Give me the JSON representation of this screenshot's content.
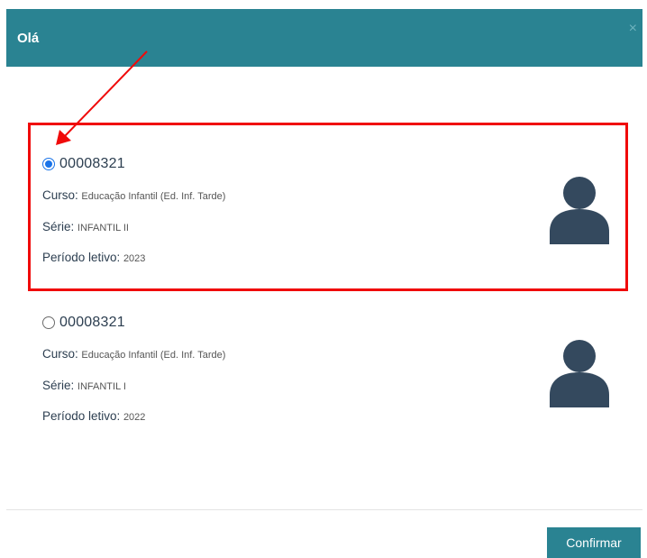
{
  "dialog": {
    "title": "Olá",
    "close_icon": "close-icon",
    "close_glyph": "×"
  },
  "enrollments": [
    {
      "selected": true,
      "id": "00008321",
      "curso_label": "Curso:",
      "curso_value": "Educação Infantil (Ed. Inf. Tarde)",
      "serie_label": "Série:",
      "serie_value": "INFANTIL II",
      "periodo_label": "Período letivo:",
      "periodo_value": "2023",
      "avatar_icon": "user-silhouette-icon"
    },
    {
      "selected": false,
      "id": "00008321",
      "curso_label": "Curso:",
      "curso_value": "Educação Infantil (Ed. Inf. Tarde)",
      "serie_label": "Série:",
      "serie_value": "INFANTIL I",
      "periodo_label": "Período letivo:",
      "periodo_value": "2022",
      "avatar_icon": "user-silhouette-icon"
    }
  ],
  "footer": {
    "confirm_label": "Confirmar"
  },
  "colors": {
    "header": "#2a8392",
    "highlight": "#f00a0a",
    "avatar": "#34495e",
    "radio_selected": "#1a73e8"
  }
}
